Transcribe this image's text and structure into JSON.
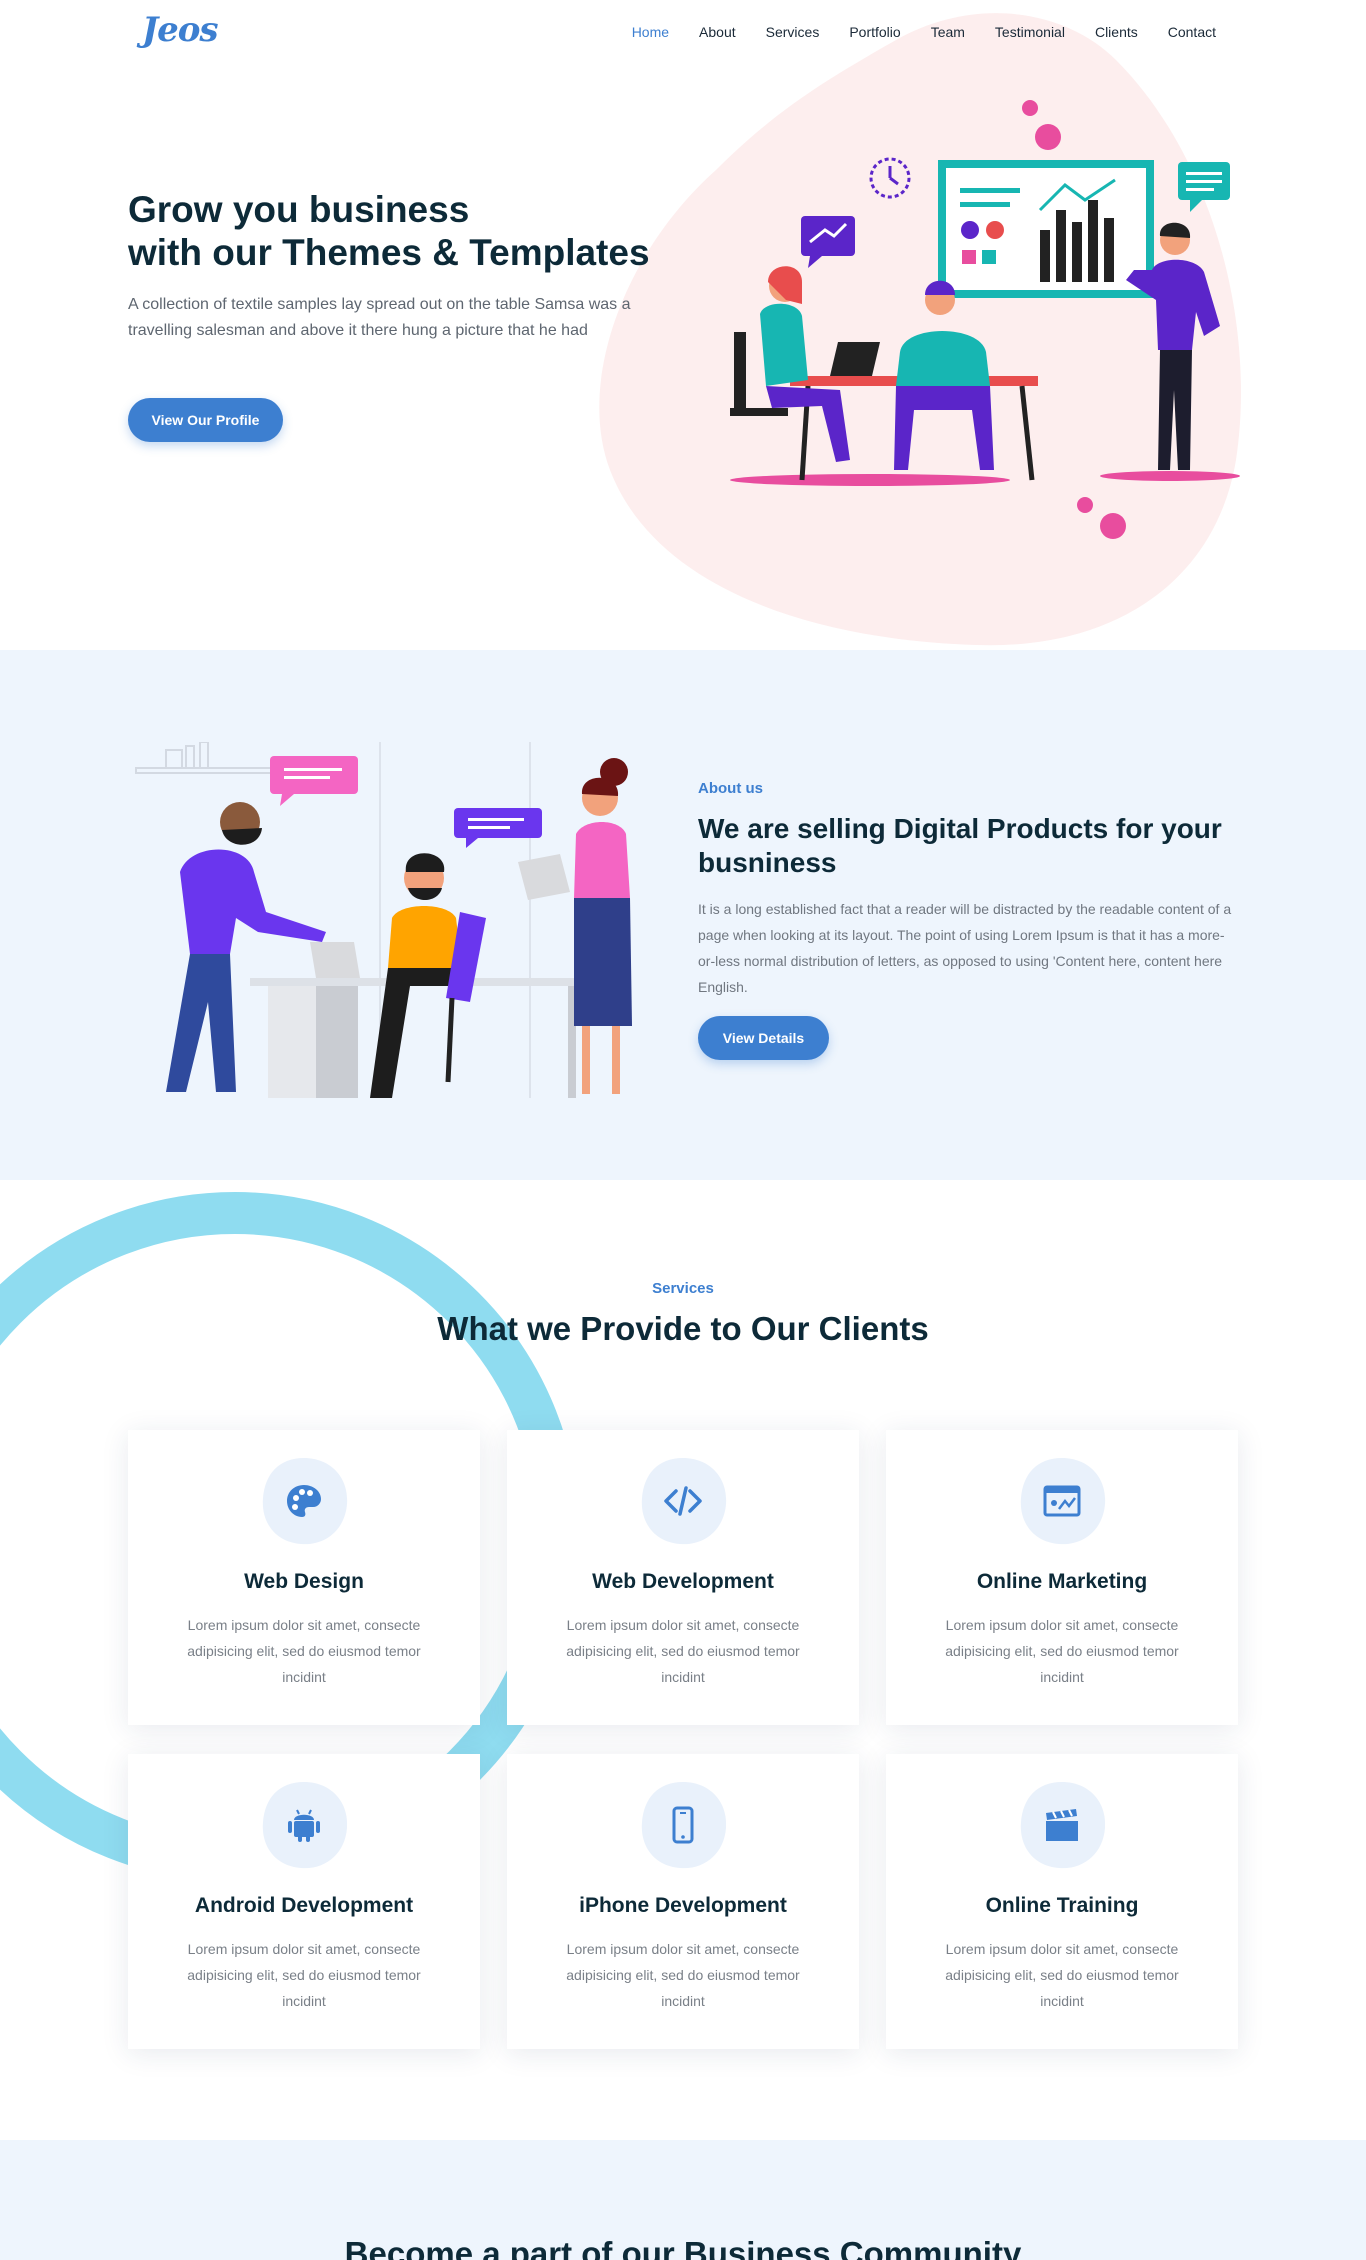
{
  "nav": {
    "logo": "Jeos",
    "items": [
      {
        "label": "Home",
        "active": true
      },
      {
        "label": "About"
      },
      {
        "label": "Services"
      },
      {
        "label": "Portfolio"
      },
      {
        "label": "Team"
      },
      {
        "label": "Testimonial"
      },
      {
        "label": "Clients"
      },
      {
        "label": "Contact"
      }
    ]
  },
  "hero": {
    "title_line1": "Grow you business",
    "title_line2": "with our Themes & Templates",
    "description": "A collection of textile samples lay spread out on the table Samsa was a travelling salesman and above it there hung a picture that he had",
    "button": "View Our Profile"
  },
  "about": {
    "kicker": "About us",
    "title": "We are selling Digital Products for your busniness",
    "description": "It is a long established fact that a reader will be distracted by the readable content of a page when looking at its layout. The point of using Lorem Ipsum is that it has a more-or-less normal distribution of letters, as opposed to using 'Content here, content here English.",
    "button": "View Details"
  },
  "services": {
    "kicker": "Services",
    "title": "What we Provide to Our Clients",
    "cards": [
      {
        "title": "Web Design",
        "icon": "palette-icon",
        "description": "Lorem ipsum dolor sit amet, consecte adipisicing elit, sed do eiusmod temor incidint"
      },
      {
        "title": "Web Development",
        "icon": "code-icon",
        "description": "Lorem ipsum dolor sit amet, consecte adipisicing elit, sed do eiusmod temor incidint"
      },
      {
        "title": "Online Marketing",
        "icon": "browser-chart-icon",
        "description": "Lorem ipsum dolor sit amet, consecte adipisicing elit, sed do eiusmod temor incidint"
      },
      {
        "title": "Android Development",
        "icon": "android-icon",
        "description": "Lorem ipsum dolor sit amet, consecte adipisicing elit, sed do eiusmod temor incidint"
      },
      {
        "title": "iPhone Development",
        "icon": "phone-icon",
        "description": "Lorem ipsum dolor sit amet, consecte adipisicing elit, sed do eiusmod temor incidint"
      },
      {
        "title": "Online Training",
        "icon": "clapperboard-icon",
        "description": "Lorem ipsum dolor sit amet, consecte adipisicing elit, sed do eiusmod temor incidint"
      }
    ]
  },
  "community": {
    "title": "Become a part of our Business Community"
  },
  "colors": {
    "accent": "#3d7fd0",
    "heading": "#0d2a38",
    "section_bg": "#eef5fd",
    "hero_blob": "#fdeeee",
    "ring": "#8fdcf0"
  }
}
